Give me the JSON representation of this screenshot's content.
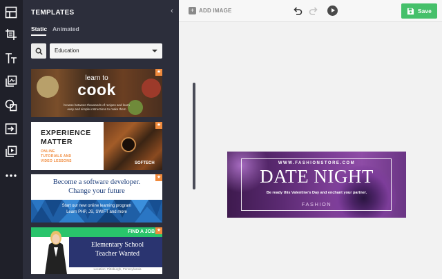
{
  "panel": {
    "title": "TEMPLATES",
    "tabs": [
      {
        "label": "Static",
        "active": true
      },
      {
        "label": "Animated",
        "active": false
      }
    ],
    "category_select": {
      "value": "Education"
    }
  },
  "rail_icons": [
    "layout-icon",
    "crop-icon",
    "text-icon",
    "layers-icon",
    "shapes-icon",
    "import-icon",
    "video-icon",
    "more-icon"
  ],
  "templates": [
    {
      "line1": "learn to",
      "line2": "cook",
      "line3": "browse between thousands of recipes and learn",
      "line4": "easy and simple instructions to make them"
    },
    {
      "line1": "EXPERIENCE",
      "line2": "MATTER",
      "line3": "ONLINE",
      "line4": "TUTORIALS AND",
      "line5": "VIDEO LESSONS",
      "brand": "SOFTECH"
    },
    {
      "line1": "Become a software developer.",
      "line2": "Change your future",
      "line3": "Start our new online learning program",
      "line4": "Learn PHP, JS, SWIFT and more"
    },
    {
      "brand": "FIND A JOB",
      "line1": "Elementary School",
      "line2": "Teacher Wanted",
      "line3": "Location: Pittsburgh, Pennsylvania"
    }
  ],
  "toolbar": {
    "add_image": "ADD IMAGE",
    "save": "Save"
  },
  "canvas": {
    "site": "WWW.FASHIONSTORE.COM",
    "title": "DATE NIGHT",
    "subtitle": "Be ready this Valentine's Day and enchant your partner.",
    "brand": "FASHION"
  },
  "colors": {
    "rail": "#1f2029",
    "panel": "#2c2e3b",
    "save_green": "#45c06a",
    "star_orange": "#f08a3c",
    "banner_purple": "#6a3584"
  }
}
